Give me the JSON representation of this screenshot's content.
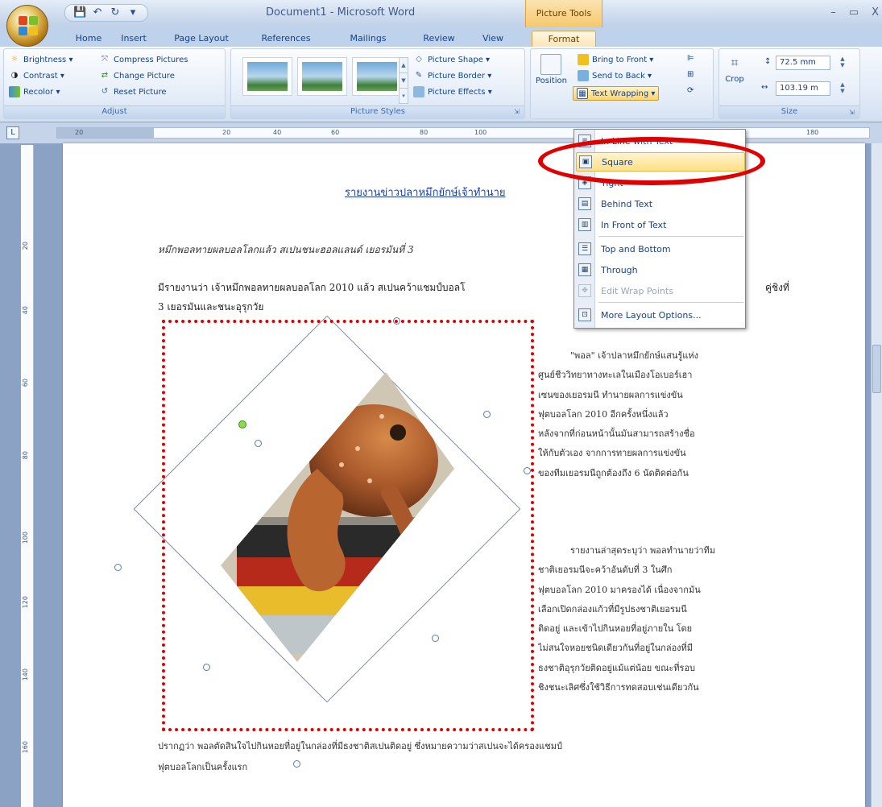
{
  "window": {
    "title": "Document1 - Microsoft Word",
    "contextual_tab_header": "Picture Tools",
    "controls": [
      "–",
      "▭",
      "X"
    ]
  },
  "quick_access": {
    "icons": [
      "save-icon",
      "undo-icon",
      "redo-icon",
      "customize-icon"
    ]
  },
  "tabs": [
    "Home",
    "Insert",
    "Page Layout",
    "References",
    "Mailings",
    "Review",
    "View",
    "Format"
  ],
  "active_tab": "Format",
  "ribbon": {
    "adjust": {
      "label": "Adjust",
      "brightness": "Brightness ▾",
      "contrast": "Contrast ▾",
      "recolor": "Recolor ▾",
      "compress": "Compress Pictures",
      "change": "Change Picture",
      "reset": "Reset Picture"
    },
    "picture_styles": {
      "label": "Picture Styles",
      "shape": "Picture Shape ▾",
      "border": "Picture Border ▾",
      "effects": "Picture Effects ▾"
    },
    "arrange": {
      "position": "Position",
      "bring_front": "Bring to Front ▾",
      "send_back": "Send to Back ▾",
      "text_wrapping": "Text Wrapping ▾"
    },
    "size": {
      "label": "Size",
      "crop": "Crop",
      "height": "72.5 mm",
      "width": "103.19 m"
    }
  },
  "ruler": {
    "h_ticks": [
      "20",
      "20",
      "40",
      "60",
      "80",
      "100",
      "180"
    ],
    "v_ticks": [
      "20",
      "40",
      "60",
      "80",
      "100",
      "120",
      "140",
      "160"
    ]
  },
  "wrap_menu": {
    "items": [
      {
        "label": "In Line with Text",
        "underline": "I",
        "disabled": false
      },
      {
        "label": "Square",
        "underline": "S",
        "disabled": false,
        "highlighted": true
      },
      {
        "label": "Tight",
        "underline": "T",
        "disabled": false
      },
      {
        "label": "Behind Text",
        "underline": "d",
        "disabled": false
      },
      {
        "label": "In Front of Text",
        "underline": "N",
        "disabled": false
      },
      {
        "label": "Top and Bottom",
        "underline": "o",
        "disabled": false
      },
      {
        "label": "Through",
        "underline": "h",
        "disabled": false
      },
      {
        "label": "Edit Wrap Points",
        "underline": "E",
        "disabled": true
      },
      {
        "label": "More Layout Options...",
        "underline": "L",
        "disabled": false
      }
    ]
  },
  "document": {
    "title": "รายงานข่าวปลาหมึกยักษ์เจ้าทำนาย",
    "subtitle": "หมึกพอลทายผลบอลโลกแล้ว สเปนชนะฮอลแลนด์ เยอรมันที่ 3",
    "para1_a": "มีรายงานว่า เจ้าหมึกพอลทายผลบอลโลก 2010 แล้ว สเปนคว้าแชมป์บอลโ",
    "para1_tail": "คู่ชิงที่",
    "para1_b": "3 เยอรมันและชนะอุรุกวัย",
    "right_col_1": [
      "\"พอล\" เจ้าปลาหมึกยักษ์แสนรู้แห่ง",
      "ศูนย์ชีววิทยาทางทะเลในเมืองโอเบอร์เฮา",
      "เซนของเยอรมนี ทำนายผลการแข่งขัน",
      "ฟุตบอลโลก 2010 อีกครั้งหนึ่งแล้ว",
      "หลังจากที่ก่อนหน้านั้นมันสามารถสร้างชื่อ",
      "ให้กับตัวเอง จากการทายผลการแข่งขัน",
      "ของทีมเยอรมนีถูกต้องถึง 6 นัดติดต่อกัน"
    ],
    "right_col_2": [
      "รายงานล่าสุดระบุว่า พอลทำนายว่าทีม",
      "ชาติเยอรมนีจะคว้าอันดับที่ 3 ในศึก",
      "ฟุตบอลโลก 2010 มาครองได้ เนื่องจากมัน",
      "เลือกเปิดกล่องแก้วที่มีรูปธงชาติเยอรมนี",
      "ติดอยู่ และเข้าไปกินหอยที่อยู่ภายใน โดย",
      "ไม่สนใจหอยชนิดเดียวกันที่อยู่ในกล่องที่มี",
      "ธงชาติอุรุกวัยติดอยู่แม้แต่น้อย ขณะที่รอบ",
      "ชิงชนะเลิศซึ่งใช้วิธีการทดสอบเช่นเดียวกัน"
    ],
    "bottom_1": "ปรากฏว่า พอลตัดสินใจไปกินหอยที่อยู่ในกล่องที่มีธงชาติสเปนติดอยู่ ซึ่งหมายความว่าสเปนจะได้ครองแชมป์",
    "bottom_2": "ฟุตบอลโลกเป็นครั้งแรก"
  },
  "colors": {
    "annotation": "#e00000",
    "menu_highlight": "#ffdf86",
    "format_tab": "#fde5b4"
  }
}
